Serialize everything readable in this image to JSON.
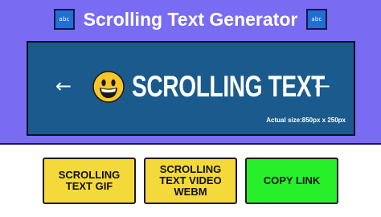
{
  "header": {
    "title": "Scrolling Text Generator",
    "left_icon": {
      "name": "abc-icon",
      "label": "abc"
    },
    "right_icon": {
      "name": "abc-icon",
      "label": "abc"
    }
  },
  "preview": {
    "text": "SCROLLING TEXT",
    "left_arrow": "←",
    "right_arrow": "←",
    "emoji": "grinning-face",
    "actual_size": "Actual size:850px x 250px"
  },
  "actions": {
    "gif_label": "SCROLLING\nTEXT GIF",
    "webm_label": "SCROLLING\nTEXT VIDEO\nWEBM",
    "copy_label": "COPY LINK"
  },
  "colors": {
    "header_bg": "#7a6cf2",
    "preview_bg": "#1a5a8c",
    "download_button": "#f4d93a",
    "copy_button": "#27ef2a"
  }
}
